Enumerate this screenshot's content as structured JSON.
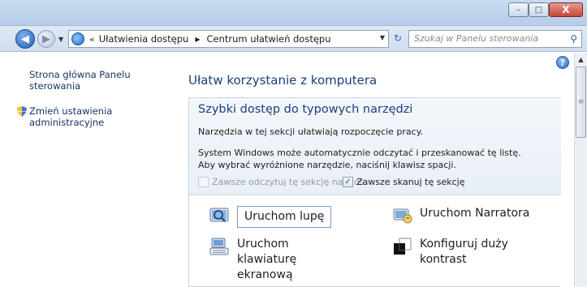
{
  "window": {
    "minimize_label": "–",
    "maximize_label": "□",
    "close_label": "X"
  },
  "navigation": {
    "breadcrumb_prefix": "«",
    "breadcrumbs": [
      "Ułatwienia dostępu",
      "Centrum ułatwień dostępu"
    ],
    "search_placeholder": "Szukaj w Panelu sterowania"
  },
  "sidebar": {
    "links": [
      {
        "label": "Strona główna Panelu sterowania"
      },
      {
        "label": "Zmień ustawienia administracyjne",
        "icon": "shield-icon"
      }
    ]
  },
  "main": {
    "title": "Ułatw korzystanie z komputera",
    "panel": {
      "title": "Szybki dostęp do typowych narzędzi",
      "description": "Narzędzia w tej sekcji ułatwiają rozpoczęcie pracy.",
      "info": "System Windows może automatycznie odczytać i przeskanować tę listę. Aby wybrać wyróżnione narzędzie, naciśnij klawisz spacji.",
      "checkbox_read": {
        "label": "Zawsze odczytuj tę sekcję na głos",
        "checked": false,
        "disabled": true
      },
      "checkbox_scan": {
        "label": "Zawsze skanuj tę sekcję",
        "checked": true,
        "disabled": false
      },
      "tools": [
        {
          "label": "Uruchom lupę",
          "icon": "magnifier-icon"
        },
        {
          "label": "Uruchom Narratora",
          "icon": "narrator-icon"
        },
        {
          "label": "Uruchom klawiaturę ekranową",
          "icon": "keyboard-icon"
        },
        {
          "label": "Konfiguruj duży kontrast",
          "icon": "contrast-icon"
        }
      ]
    }
  },
  "colors": {
    "link": "#15325f",
    "heading": "#1b3e7a",
    "panel_bg": "#eef3f9",
    "close_button": "#c7453a"
  }
}
